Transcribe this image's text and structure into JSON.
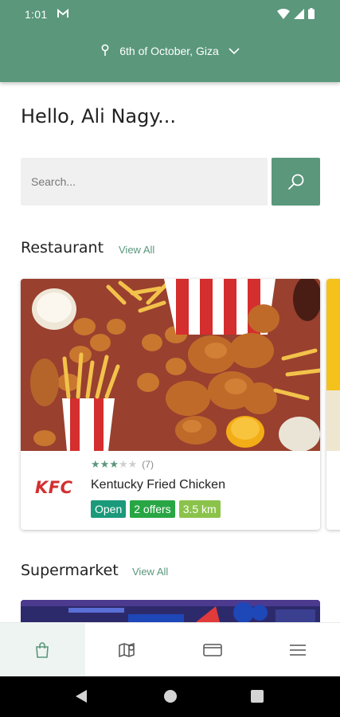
{
  "status_bar": {
    "time": "1:01"
  },
  "header": {
    "location": "6th of October, Giza"
  },
  "greeting": "Hello, Ali Nagy...",
  "search": {
    "placeholder": "Search..."
  },
  "sections": {
    "restaurant": {
      "title": "Restaurant",
      "view_all": "View All"
    },
    "supermarket": {
      "title": "Supermarket",
      "view_all": "View All"
    }
  },
  "restaurant_card": {
    "logo": "KFC",
    "name": "Kentucky Fried Chicken",
    "rating": 3,
    "rating_max": 5,
    "rating_count": "(7)",
    "badges": [
      {
        "label": "Open",
        "color": "#1a9a7a"
      },
      {
        "label": "2 offers",
        "color": "#27a643"
      },
      {
        "label": "3.5 km",
        "color": "#8bc34a"
      }
    ]
  },
  "bottom_nav": [
    {
      "name": "shop",
      "icon": "shopping-bag-icon",
      "active": true
    },
    {
      "name": "map",
      "icon": "map-pin-icon",
      "active": false
    },
    {
      "name": "cards",
      "icon": "credit-card-icon",
      "active": false
    },
    {
      "name": "menu",
      "icon": "hamburger-menu-icon",
      "active": false
    }
  ],
  "colors": {
    "brand": "#5a977b",
    "kfc_red": "#d32f2f",
    "star": "#5a977b"
  }
}
